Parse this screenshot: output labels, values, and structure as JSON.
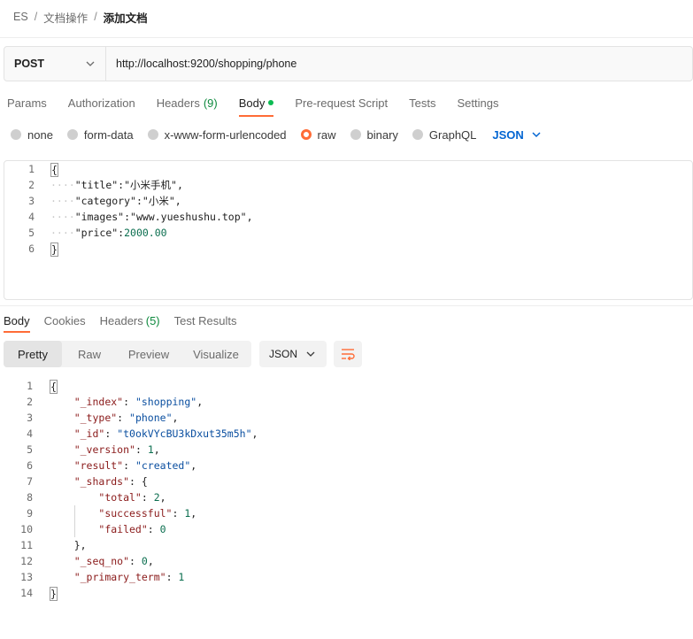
{
  "breadcrumb": {
    "items": [
      "ES",
      "文档操作",
      "添加文档"
    ]
  },
  "request": {
    "method": "POST",
    "url": "http://localhost:9200/shopping/phone"
  },
  "request_tabs": [
    {
      "label": "Params"
    },
    {
      "label": "Authorization"
    },
    {
      "label": "Headers",
      "count": "(9)"
    },
    {
      "label": "Body"
    },
    {
      "label": "Pre-request Script"
    },
    {
      "label": "Tests"
    },
    {
      "label": "Settings"
    }
  ],
  "body_types": {
    "options": [
      "none",
      "form-data",
      "x-www-form-urlencoded",
      "raw",
      "binary",
      "GraphQL"
    ],
    "selected": "raw",
    "format": "JSON"
  },
  "request_body": {
    "line_numbers": [
      "1",
      "2",
      "3",
      "4",
      "5",
      "6"
    ],
    "title_key": "\"title\"",
    "title_val": "\"小米手机\"",
    "category_key": "\"category\"",
    "category_val": "\"小米\"",
    "images_key": "\"images\"",
    "images_val": "\"www.yueshushu.top\"",
    "price_key": "\"price\"",
    "price_val": "2000.00"
  },
  "response_tabs": [
    {
      "label": "Body"
    },
    {
      "label": "Cookies"
    },
    {
      "label": "Headers",
      "count": "(5)"
    },
    {
      "label": "Test Results"
    }
  ],
  "view_modes": [
    "Pretty",
    "Raw",
    "Preview",
    "Visualize"
  ],
  "response_format": "JSON",
  "response_body": {
    "line_numbers": [
      "1",
      "2",
      "3",
      "4",
      "5",
      "6",
      "7",
      "8",
      "9",
      "10",
      "11",
      "12",
      "13",
      "14"
    ],
    "index_key": "\"_index\"",
    "index_val": "\"shopping\"",
    "type_key": "\"_type\"",
    "type_val": "\"phone\"",
    "id_key": "\"_id\"",
    "id_val": "\"t0okVYcBU3kDxut35m5h\"",
    "version_key": "\"_version\"",
    "version_val": "1",
    "result_key": "\"result\"",
    "result_val": "\"created\"",
    "shards_key": "\"_shards\"",
    "total_key": "\"total\"",
    "total_val": "2",
    "successful_key": "\"successful\"",
    "successful_val": "1",
    "failed_key": "\"failed\"",
    "failed_val": "0",
    "seq_key": "\"_seq_no\"",
    "seq_val": "0",
    "primary_key": "\"_primary_term\"",
    "primary_val": "1"
  },
  "colors": {
    "accent": "#ff6c37",
    "link": "#0265d2",
    "count": "#0f8a3f"
  }
}
